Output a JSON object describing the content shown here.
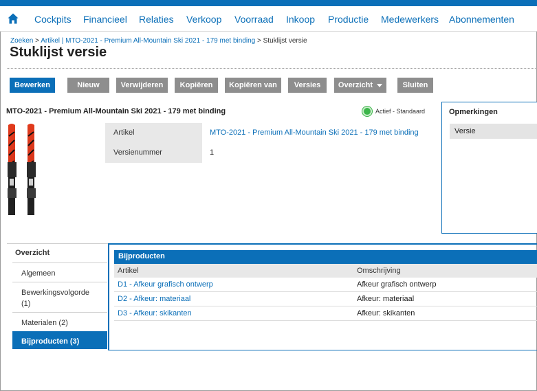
{
  "nav": {
    "home_icon": "home-icon",
    "items": [
      "Cockpits",
      "Financieel",
      "Relaties",
      "Verkoop",
      "Voorraad",
      "Inkoop",
      "Productie",
      "Medewerkers",
      "Abonnementen"
    ]
  },
  "breadcrumb": {
    "items": [
      "Zoeken",
      "Artikel | MTO-2021 - Premium All-Mountain Ski 2021 - 179 met binding"
    ],
    "separator": ">",
    "current": "Stuklijst versie"
  },
  "page_title": "Stuklijst versie",
  "toolbar": {
    "buttons": [
      "Bewerken",
      "Nieuw",
      "Verwijderen",
      "Kopiëren",
      "Kopiëren van",
      "Versies",
      "Overzicht",
      "Sluiten"
    ]
  },
  "item": {
    "title": "MTO-2021 - Premium All-Mountain Ski 2021 - 179 met binding",
    "status": "Actief - Standaard",
    "image_icon": "ski-image"
  },
  "properties": {
    "article_label": "Artikel",
    "article_value": "MTO-2021 - Premium All-Mountain Ski 2021 - 179 met binding",
    "version_label": "Versienummer",
    "version_value": "1"
  },
  "remarks": {
    "title": "Opmerkingen",
    "row": "Versie"
  },
  "sidebar": {
    "heading": "Overzicht",
    "items": [
      {
        "label": "Algemeen"
      },
      {
        "label": "Bewerkingsvolgorde (1)"
      },
      {
        "label": "Materialen (2)"
      },
      {
        "label": "Bijproducten (3)"
      }
    ]
  },
  "byproducts": {
    "title": "Bijproducten",
    "columns": [
      "Artikel",
      "Omschrijving"
    ],
    "rows": [
      {
        "article": "D1 - Afkeur grafisch ontwerp",
        "description": "Afkeur grafisch ontwerp"
      },
      {
        "article": "D2 - Afkeur: materiaal",
        "description": "Afkeur: materiaal"
      },
      {
        "article": "D3 - Afkeur: skikanten",
        "description": "Afkeur: skikanten"
      }
    ]
  },
  "colors": {
    "accent": "#0b6fb8",
    "button_gray": "#8e8e8e",
    "status_green": "#3cb54a"
  }
}
